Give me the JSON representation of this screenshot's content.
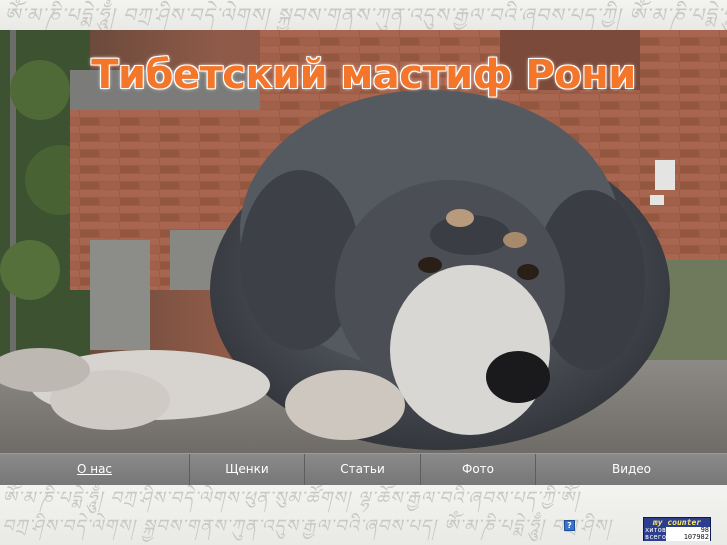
{
  "decor": {
    "top_script": "ཨོཾ་མ་ཎི་པདྨེ་ཧཱུྃ། བཀྲ་ཤིས་བདེ་ལེགས། སྐྱབས་གནས་ཀུན་འདུས་རྒྱལ་བའི་ཞབས་པད་ཀྱི། ཨོཾ་མ་ཎི་པདྨེ་ཧཱུྃ།",
    "bottom_script_1": "ཨོཾ་མ་ཎི་པདྨེ་ཧཱུྃ། བཀྲ་ཤིས་བདེ་ལེགས་ཕུན་སུམ་ཚོགས། ལྷ་ཆོས་རྒྱལ་བའི་ཞབས་པད་ཀྱི་ཨོཾ།",
    "bottom_script_2": "བཀྲ་ཤིས་བདེ་ལེགས། སྐྱབས་གནས་ཀུན་འདུས་རྒྱལ་བའི་ཞབས་པད། ཨོཾ་མ་ཎི་པདྨེ་ཧཱུྃ། བཀྲ་ཤིས།"
  },
  "header": {
    "title": "Тибетский мастиф Рони"
  },
  "nav": {
    "items": [
      {
        "label": "О нас",
        "active": true
      },
      {
        "label": "Щенки",
        "active": false
      },
      {
        "label": "Статьи",
        "active": false
      },
      {
        "label": "Фото",
        "active": false
      },
      {
        "label": "Видео",
        "active": false
      }
    ]
  },
  "footer": {
    "help_icon": "?",
    "counter": {
      "title": "my counter",
      "rows": [
        {
          "label": "хитов",
          "value": "98"
        },
        {
          "label": "всего",
          "value": "107982"
        }
      ]
    }
  },
  "colors": {
    "title_orange": "#f3762a",
    "nav_gray": "#808080",
    "counter_blue": "#2c3f8f"
  }
}
